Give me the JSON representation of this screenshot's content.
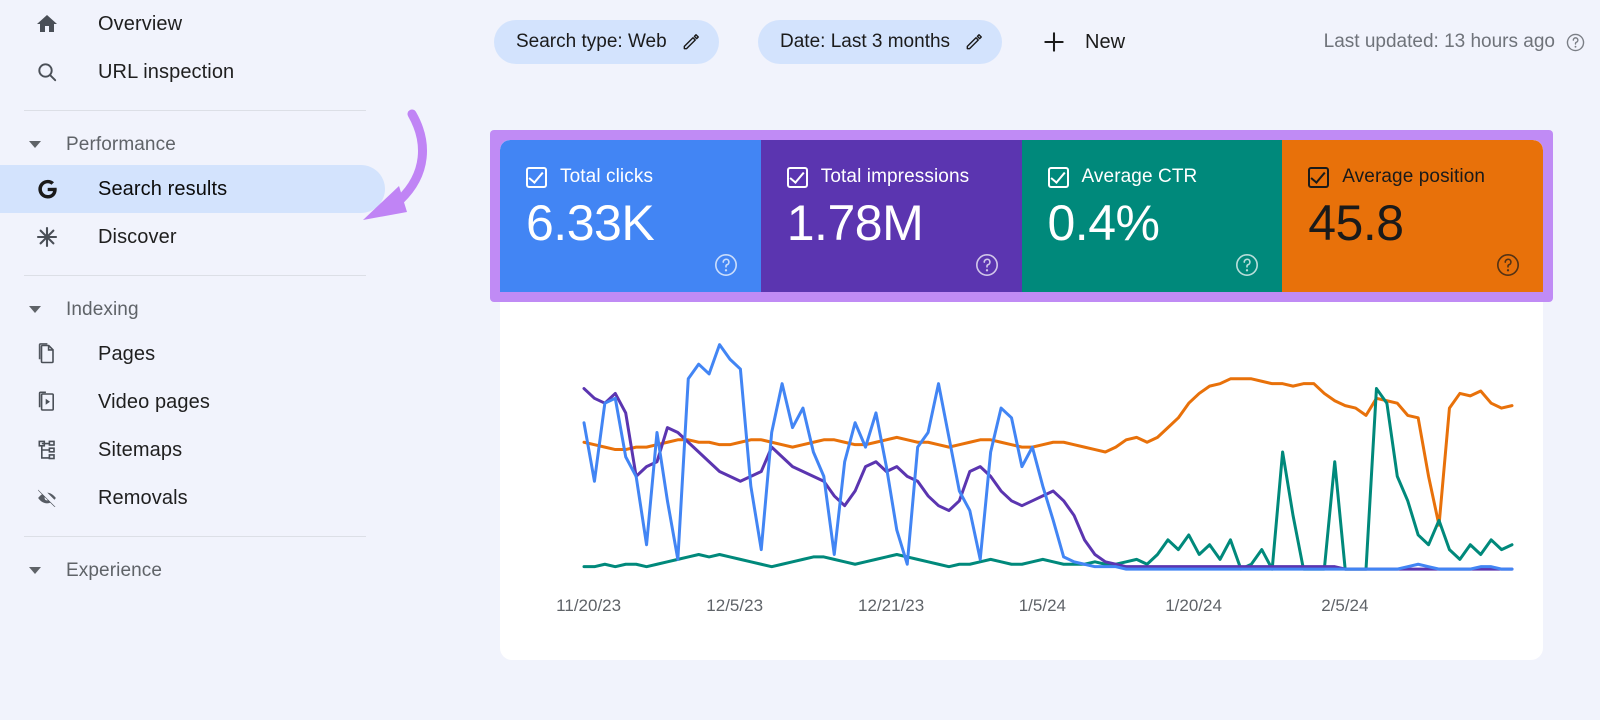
{
  "sidebar": {
    "top_items": [
      {
        "label": "Overview",
        "icon": "home-icon",
        "selected": false
      },
      {
        "label": "URL inspection",
        "icon": "search-icon",
        "selected": false
      }
    ],
    "groups": [
      {
        "title": "Performance",
        "expanded": true,
        "items": [
          {
            "label": "Search results",
            "icon": "google-g-icon",
            "selected": true
          },
          {
            "label": "Discover",
            "icon": "asterisk-icon",
            "selected": false
          }
        ]
      },
      {
        "title": "Indexing",
        "expanded": true,
        "items": [
          {
            "label": "Pages",
            "icon": "pages-icon",
            "selected": false
          },
          {
            "label": "Video pages",
            "icon": "video-pages-icon",
            "selected": false
          },
          {
            "label": "Sitemaps",
            "icon": "sitemaps-icon",
            "selected": false
          },
          {
            "label": "Removals",
            "icon": "eye-off-icon",
            "selected": false
          }
        ]
      },
      {
        "title": "Experience",
        "expanded": true,
        "items": []
      }
    ]
  },
  "toolbar": {
    "search_type_chip": "Search type: Web",
    "date_chip": "Date: Last 3 months",
    "new_button": "New",
    "last_updated": "Last updated: 13 hours ago"
  },
  "metrics": [
    {
      "name": "Total clicks",
      "value": "6.33K",
      "checked": true,
      "color": "#4285F4",
      "text_color": "#FFFFFF"
    },
    {
      "name": "Total impressions",
      "value": "1.78M",
      "checked": true,
      "color": "#5B35B0",
      "text_color": "#FFFFFF"
    },
    {
      "name": "Average CTR",
      "value": "0.4%",
      "checked": true,
      "color": "#00897B",
      "text_color": "#FFFFFF"
    },
    {
      "name": "Average position",
      "value": "45.8",
      "checked": true,
      "color": "#E8710A",
      "text_color": "#1A1A1A"
    }
  ],
  "annotation": {
    "highlight_color": "#C08BF5",
    "arrow_color": "#C084F5",
    "arrow_target": "Search results"
  },
  "chart_data": {
    "type": "line",
    "title": "",
    "xlabel": "",
    "ylabel": "",
    "grid": false,
    "legend_position": "cards-above",
    "x_tick_labels": [
      "11/20/23",
      "12/5/23",
      "12/21/23",
      "1/5/24",
      "1/20/24",
      "2/5/24"
    ],
    "x_tick_positions_pct": [
      8.5,
      22.5,
      37.5,
      52.0,
      66.5,
      81.0
    ],
    "n_points": 90,
    "series": [
      {
        "name": "Total clicks",
        "color": "#4285F4",
        "values": [
          62,
          38,
          70,
          72,
          48,
          40,
          12,
          58,
          30,
          6,
          80,
          86,
          82,
          94,
          88,
          84,
          36,
          10,
          58,
          78,
          60,
          68,
          50,
          40,
          8,
          46,
          62,
          52,
          66,
          44,
          18,
          4,
          52,
          58,
          78,
          56,
          34,
          26,
          6,
          50,
          68,
          64,
          44,
          52,
          36,
          22,
          7,
          5,
          4,
          3,
          3,
          3,
          2,
          2,
          2,
          2,
          2,
          2,
          2,
          2,
          2,
          2,
          2,
          2,
          2,
          2,
          2,
          2,
          2,
          2,
          2,
          2,
          2,
          2,
          2,
          2,
          2,
          2,
          2,
          3,
          4,
          3,
          2,
          2,
          2,
          2,
          3,
          3,
          2,
          2
        ]
      },
      {
        "name": "Total impressions",
        "color": "#5B35B0",
        "values": [
          76,
          72,
          70,
          74,
          66,
          40,
          44,
          46,
          60,
          58,
          54,
          50,
          46,
          42,
          40,
          38,
          40,
          42,
          52,
          48,
          44,
          42,
          40,
          38,
          32,
          28,
          34,
          44,
          46,
          42,
          44,
          40,
          38,
          32,
          28,
          26,
          30,
          42,
          44,
          40,
          34,
          30,
          28,
          30,
          32,
          34,
          30,
          24,
          14,
          8,
          5,
          4,
          3,
          3,
          3,
          3,
          3,
          3,
          3,
          3,
          3,
          3,
          3,
          3,
          3,
          3,
          3,
          3,
          3,
          3,
          3,
          3,
          3,
          2,
          2,
          2,
          2,
          2,
          2,
          2,
          2,
          2,
          2,
          2,
          2,
          2,
          2,
          2,
          2,
          2
        ]
      },
      {
        "name": "Average CTR",
        "color": "#00897B",
        "values": [
          3,
          3,
          4,
          3,
          4,
          4,
          3,
          4,
          5,
          6,
          7,
          8,
          7,
          8,
          7,
          6,
          5,
          4,
          3,
          4,
          5,
          6,
          7,
          7,
          6,
          5,
          4,
          5,
          6,
          7,
          8,
          7,
          6,
          5,
          4,
          3,
          4,
          4,
          5,
          6,
          5,
          4,
          4,
          5,
          6,
          5,
          4,
          4,
          4,
          5,
          4,
          4,
          5,
          6,
          4,
          8,
          14,
          10,
          16,
          8,
          12,
          6,
          14,
          2,
          4,
          10,
          2,
          50,
          24,
          2,
          2,
          2,
          46,
          2,
          2,
          2,
          76,
          70,
          40,
          30,
          16,
          12,
          22,
          10,
          6,
          12,
          8,
          14,
          10,
          12
        ]
      },
      {
        "name": "Average position",
        "color": "#E8710A",
        "values": [
          54,
          53,
          52,
          51,
          51,
          52,
          52,
          53,
          54,
          55,
          55,
          54,
          54,
          53,
          53,
          54,
          55,
          55,
          54,
          53,
          52,
          53,
          54,
          55,
          55,
          54,
          53,
          53,
          54,
          55,
          56,
          55,
          54,
          54,
          53,
          52,
          53,
          54,
          55,
          55,
          54,
          53,
          52,
          52,
          53,
          54,
          54,
          53,
          52,
          51,
          50,
          52,
          55,
          56,
          54,
          56,
          60,
          64,
          70,
          74,
          77,
          78,
          80,
          80,
          80,
          79,
          78,
          78,
          77,
          78,
          78,
          74,
          71,
          69,
          68,
          65,
          72,
          71,
          70,
          65,
          64,
          40,
          20,
          68,
          74,
          73,
          75,
          70,
          68,
          69
        ]
      }
    ],
    "notes": "Four metric series plotted over ~3 months; clicks and impressions collapse to near zero after early January; average position (orange) rises through late January and dips sharply in early February; average CTR (green) spikes in February."
  }
}
